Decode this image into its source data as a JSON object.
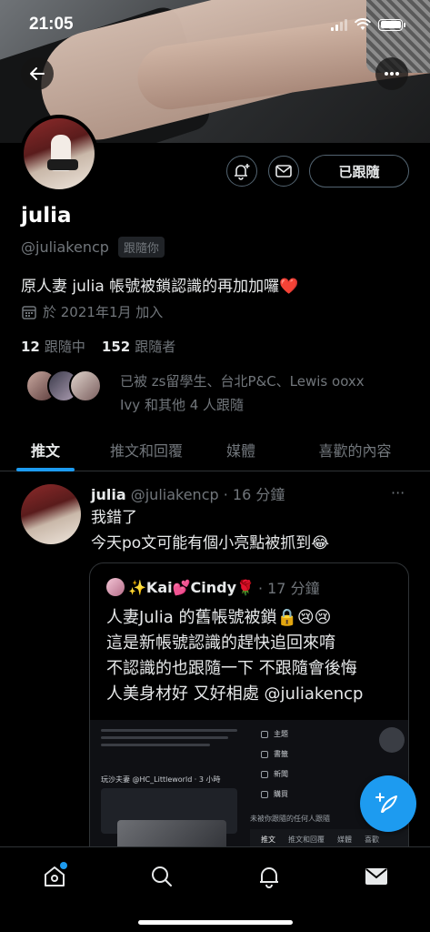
{
  "status_bar": {
    "time": "21:05"
  },
  "profile": {
    "name": "julia",
    "handle": "@juliakencp",
    "follows_you": "跟隨你",
    "bio": "原人妻 julia 帳號被鎖認識的再加加囉❤️",
    "joined": "於 2021年1月 加入",
    "following_count": "12",
    "following_label": "跟隨中",
    "followers_count": "152",
    "followers_label": "跟隨者",
    "followed_by_line1": "已被 zs留學生、台北P&C、Lewis ooxx",
    "followed_by_line2": "Ivy 和其他 4 人跟隨",
    "follow_button": "已跟隨"
  },
  "tabs": [
    {
      "label": "推文"
    },
    {
      "label": "推文和回覆"
    },
    {
      "label": "媒體"
    },
    {
      "label": "喜歡的內容"
    }
  ],
  "tweet": {
    "name": "julia",
    "meta": "@juliakencp · 16 分鐘",
    "line1": "我錯了",
    "line2": "今天po文可能有個小亮點被抓到😂",
    "more": "···",
    "quote": {
      "name": "✨Kai💕Cindy🌹",
      "meta": "· 17 分鐘",
      "line1": "人妻Julia 的舊帳號被鎖🔒😢😢",
      "line2": "這是新帳號認識的趕快追回來唷",
      "line3": "不認識的也跟隨一下 不跟隨會後悔",
      "line4": "人美身材好 又好相處 @juliakencp",
      "img_menu": [
        "主題",
        "書籤",
        "新聞",
        "購買"
      ],
      "img_tabs": [
        "推文",
        "推文和回覆",
        "媒體",
        "喜歡"
      ],
      "img_caption": "未被你跟隨的任何人跟隨",
      "img_user": "玩沙夫妻 @HC_Littleworld · 3 小時"
    }
  },
  "colors": {
    "accent": "#1d9bf0",
    "text": "#e7e9ea",
    "muted": "#71767b",
    "border": "#2f3336"
  }
}
